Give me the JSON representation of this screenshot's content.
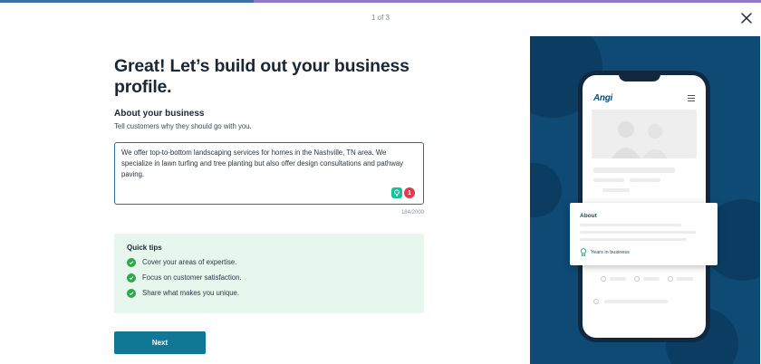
{
  "progress": {
    "value": 0.333,
    "step_text": "1 of 3"
  },
  "header": {
    "close_label": "Close"
  },
  "form": {
    "title": "Great! Let’s build out your business profile.",
    "section_label": "About your business",
    "section_sub": "Tell customers why they should go with you.",
    "description_value": "We offer top-to-bottom landscaping services for homes in the Nashville, TN area. We specialize in lawn turfing and tree planting but also offer design consultations and pathway paving.",
    "grammar_badge_count": "1",
    "char_count": "184/2000"
  },
  "tips": {
    "title": "Quick tips",
    "items": [
      "Cover your areas of expertise.",
      "Focus on customer satisfaction.",
      "Share what makes you unique."
    ]
  },
  "actions": {
    "next_label": "Next"
  },
  "preview": {
    "logo_text": "Angi",
    "about_title": "About",
    "years_label": "Years in business"
  },
  "colors": {
    "primary": "#107895",
    "panel": "#0f4a75",
    "tips_bg": "#e8f7ee",
    "check": "#2aa84a"
  }
}
